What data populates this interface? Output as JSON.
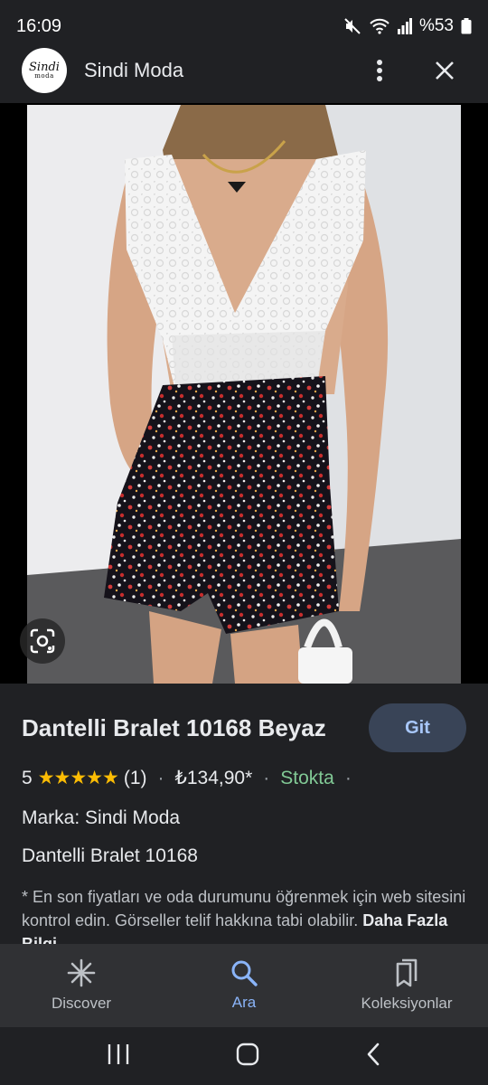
{
  "status": {
    "time": "16:09",
    "battery": "%53",
    "icons": [
      "mute-icon",
      "wifi-icon",
      "signal-icon",
      "battery-icon"
    ]
  },
  "header": {
    "logo_line1": "Sindi",
    "logo_line2": "moda",
    "site_name": "Sindi Moda",
    "icons": [
      "more-vert-icon",
      "close-icon"
    ]
  },
  "product": {
    "title": "Dantelli Bralet 10168 Beyaz",
    "visit_button": "Git",
    "rating": "5",
    "stars": "★★★★★",
    "review_count": "(1)",
    "price": "₺134,90*",
    "stock": "Stokta",
    "brand": "Marka: Sindi Moda",
    "model": "Dantelli Bralet 10168",
    "disclaimer": "* En son fiyatları ve oda durumunu öğrenmek için web sitesini kontrol edin. Görseller telif hakkına tabi olabilir.",
    "more_info": "Daha Fazla Bilgi"
  },
  "bottom_nav": {
    "items": [
      {
        "label": "Discover",
        "icon": "discover-icon"
      },
      {
        "label": "Ara",
        "icon": "search-icon"
      },
      {
        "label": "Koleksiyonlar",
        "icon": "collections-icon"
      }
    ]
  },
  "colors": {
    "background": "#202124",
    "accent": "#8ab4f8",
    "stock": "#81c995",
    "star": "#fbbc04",
    "button": "#394457"
  }
}
